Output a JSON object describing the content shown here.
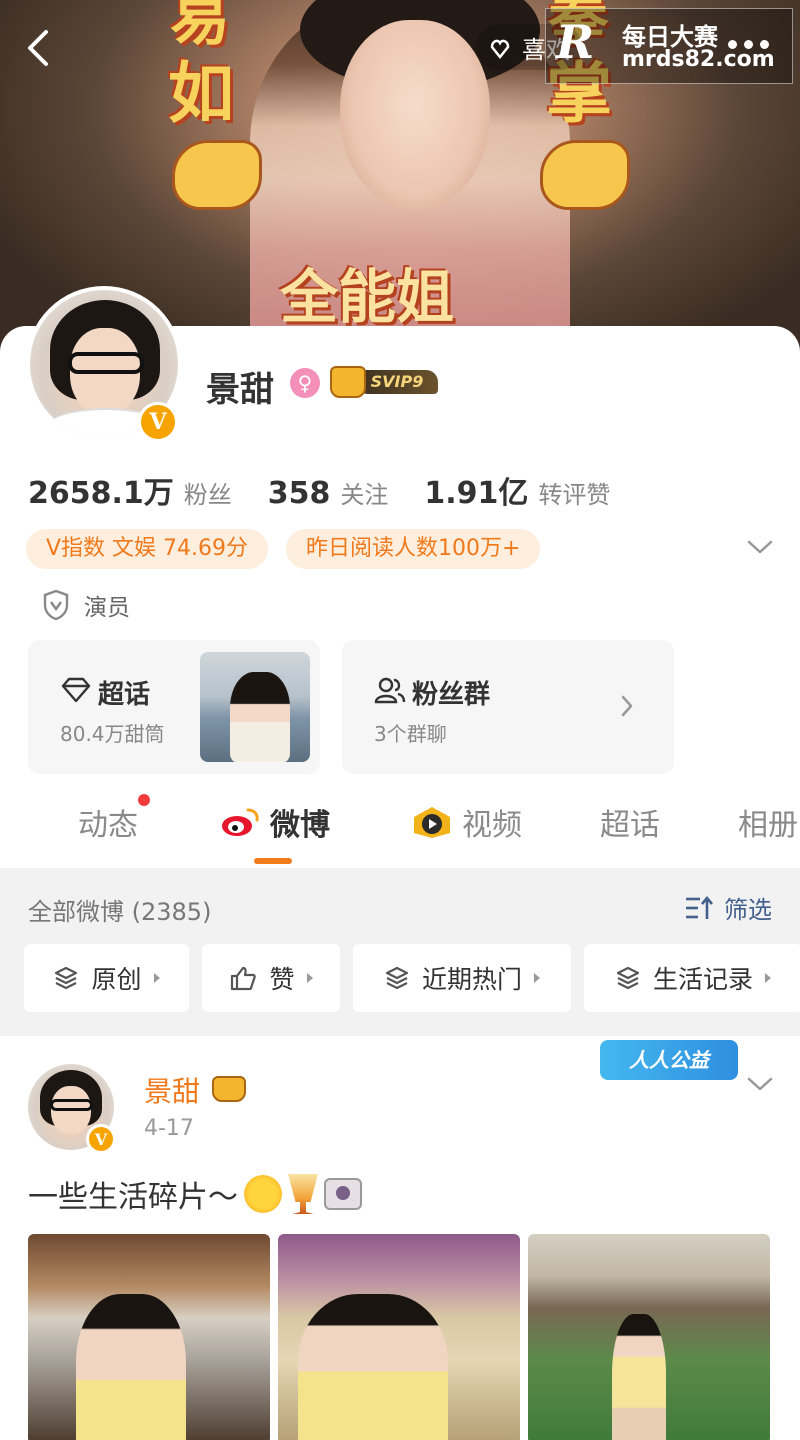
{
  "header": {
    "back_label": "",
    "like_label": "喜欢",
    "watermark": {
      "title": "每日大赛",
      "url": "mrds82.com",
      "logo_letter": "R"
    }
  },
  "cover": {
    "deco_top_left": "易",
    "deco_top_right": "拳",
    "deco_left": "如",
    "deco_right": "掌",
    "banner_text": "全能姐"
  },
  "profile": {
    "name": "景甜",
    "gender_symbol": "♀",
    "vip_label": "SVIP9",
    "verified_badge": "V",
    "stats": [
      {
        "num": "2658.1万",
        "label": "粉丝"
      },
      {
        "num": "358",
        "label": "关注"
      },
      {
        "num": "1.91亿",
        "label": "转评赞"
      }
    ],
    "tags": [
      "V指数 文娱 74.69分",
      "昨日阅读人数100万+"
    ],
    "identity": "演员"
  },
  "features": {
    "super_topic": {
      "title": "超话",
      "sub": "80.4万甜筒"
    },
    "fans_group": {
      "title": "粉丝群",
      "sub": "3个群聊"
    }
  },
  "tabs": [
    {
      "label": "动态",
      "has_dot": true
    },
    {
      "label": "微博",
      "active": true
    },
    {
      "label": "视频"
    },
    {
      "label": "超话"
    },
    {
      "label": "相册"
    }
  ],
  "filter": {
    "title": "全部微博 (2385)",
    "filter_button": "筛选",
    "chips": [
      "原创",
      "赞",
      "近期热门",
      "生活记录"
    ]
  },
  "post": {
    "author": "景甜",
    "date": "4-17",
    "badge": "人人公益",
    "text": "一些生活碎片～"
  },
  "colors": {
    "accent_orange": "#f07a1b",
    "tag_bg": "#fdeede",
    "link_blue": "#44618e",
    "notification_red": "#f23b3b"
  }
}
